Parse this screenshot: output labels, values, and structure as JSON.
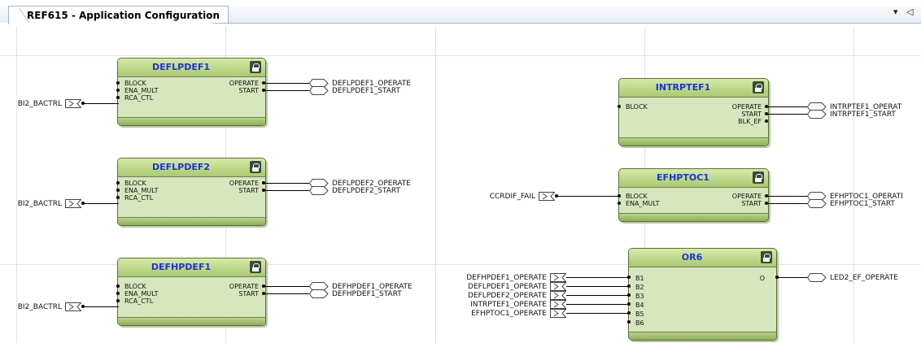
{
  "tab": {
    "title": "REF615 - Application Configuration",
    "menu_glyph": "▾",
    "nav_glyph": "◁"
  },
  "blocks": {
    "deflpdef1": {
      "title": "DEFLPDEF1",
      "inputs": [
        "BLOCK",
        "ENA_MULT",
        "RCA_CTL"
      ],
      "outputs": [
        "OPERATE",
        "START"
      ]
    },
    "deflpdef2": {
      "title": "DEFLPDEF2",
      "inputs": [
        "BLOCK",
        "ENA_MULT",
        "RCA_CTL"
      ],
      "outputs": [
        "OPERATE",
        "START"
      ]
    },
    "defhpdef1": {
      "title": "DEFHPDEF1",
      "inputs": [
        "BLOCK",
        "ENA_MULT",
        "RCA_CTL"
      ],
      "outputs": [
        "OPERATE",
        "START"
      ]
    },
    "intrptef1": {
      "title": "INTRPTEF1",
      "inputs": [
        "BLOCK"
      ],
      "outputs": [
        "OPERATE",
        "START",
        "BLK_EF"
      ]
    },
    "efhptoc1": {
      "title": "EFHPTOC1",
      "inputs": [
        "BLOCK",
        "ENA_MULT"
      ],
      "outputs": [
        "OPERATE",
        "START"
      ]
    },
    "or6": {
      "title": "OR6",
      "inputs": [
        "B1",
        "B2",
        "B3",
        "B4",
        "B5",
        "B6"
      ],
      "outputs": [
        "O"
      ]
    }
  },
  "signals": {
    "bi2_bactrl": "BI2_BACTRL",
    "ccrdif_fail": "CCRDIF_FAIL",
    "deflpdef1_operate": "DEFLPDEF1_OPERATE",
    "deflpdef1_start": "DEFLPDEF1_START",
    "deflpdef2_operate": "DEFLPDEF2_OPERATE",
    "deflpdef2_start": "DEFLPDEF2_START",
    "defhpdef1_operate": "DEFHPDEF1_OPERATE",
    "defhpdef1_start": "DEFHPDEF1_START",
    "intrptef1_operate": "INTRPTEF1_OPERAT",
    "intrptef1_start": "INTRPTEF1_START",
    "efhptoc1_operate": "EFHPTOC1_OPERATI",
    "efhptoc1_start": "EFHPTOC1_START",
    "led2_ef_operate": "LED2_EF_OPERATE",
    "or_in_1": "DEFHPDEF1_OPERATE",
    "or_in_2": "DEFLPDEF1_OPERATE",
    "or_in_3": "DEFLPDEF2_OPERATE",
    "or_in_4": "INTRPTEF1_OPERATE",
    "or_in_5": "EFHPTOC1_OPERATE"
  }
}
